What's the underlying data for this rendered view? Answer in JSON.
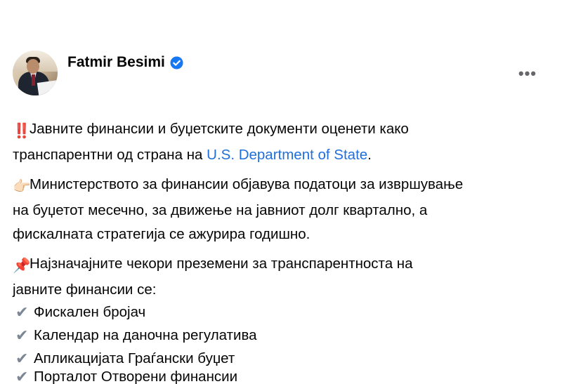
{
  "author": {
    "name": "Fatmir Besimi",
    "avatar_icon": "profile-photo",
    "verified_icon": "verified-badge-icon"
  },
  "more_label": "•••",
  "paragraphs": {
    "p1": {
      "emoji": "‼️",
      "text_a": "Јавните финансии и буџетските документи оценети како",
      "text_b": "транспарентни од страна на ",
      "link": "U.S. Department of State",
      "text_c": "."
    },
    "p2": {
      "emoji": "👉🏻",
      "line1": "Министерството за финансии објавува податоци за извршување",
      "line2": "на буџетот месечно, за движење на јавниот долг квартално, а",
      "line3": "фискалната стратегија се ажурира годишно."
    },
    "p3": {
      "emoji": "📌",
      "line1": "Најзначајните чекори преземени за транспарентноста на",
      "line2": "јавните финансии се:"
    }
  },
  "list_items": [
    "Фискален бројач",
    "Календар на даночна регулатива",
    "Апликацијата Граѓански буџет",
    "Порталот Отворени финансии"
  ],
  "colors": {
    "link": "#216fdb",
    "verified": "#1877f2",
    "text": "#050505",
    "muted": "#65676b"
  }
}
